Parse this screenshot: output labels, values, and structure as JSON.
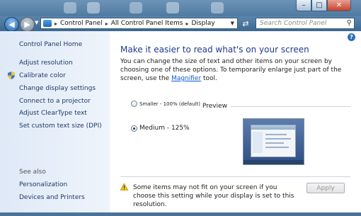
{
  "window": {
    "minimize": "–",
    "maximize": "□",
    "close": "✕"
  },
  "nav": {
    "breadcrumbs": [
      "Control Panel",
      "All Control Panel Items",
      "Display"
    ],
    "search_placeholder": "Search Control Panel"
  },
  "sidebar": {
    "home": "Control Panel Home",
    "items": [
      "Adjust resolution",
      "Calibrate color",
      "Change display settings",
      "Connect to a projector",
      "Adjust ClearType text",
      "Set custom text size (DPI)"
    ],
    "see_also_label": "See also",
    "see_also": [
      "Personalization",
      "Devices and Printers"
    ]
  },
  "main": {
    "heading": "Make it easier to read what's on your screen",
    "desc_part1": "You can change the size of text and other items on your screen by choosing one of these options. To temporarily enlarge just part of the screen, use the ",
    "desc_link": "Magnifier",
    "desc_part2": " tool.",
    "options": [
      {
        "label": "Smaller - 100% (default)",
        "checked": false
      },
      {
        "label": "Medium - 125%",
        "checked": true
      }
    ],
    "preview_label": "Preview",
    "warning": "Some items may not fit on your screen if you choose this setting while your display is set to this resolution.",
    "apply_label": "Apply"
  },
  "colors": {
    "heading": "#1e3c8c",
    "link": "#0b5cd6",
    "sidebar_bg": "#dfe9f7"
  }
}
